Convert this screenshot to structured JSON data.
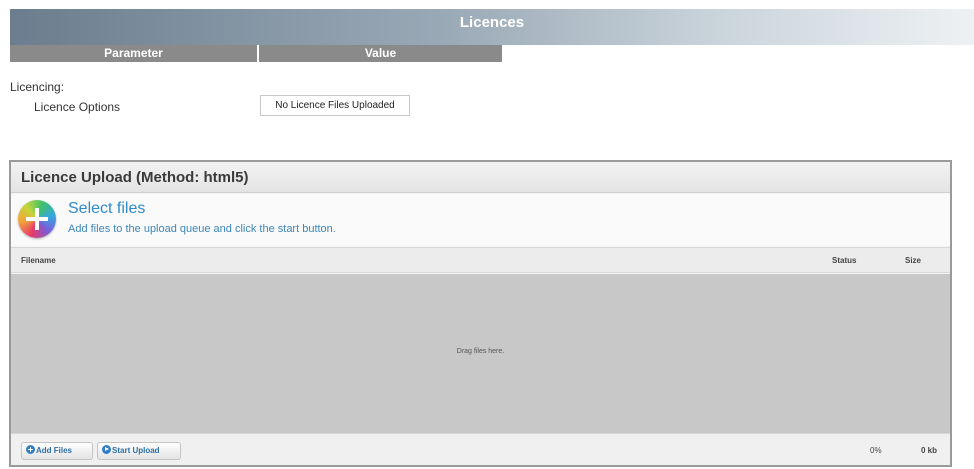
{
  "page": {
    "title": "Licences"
  },
  "params_table": {
    "header_parameter": "Parameter",
    "header_value": "Value",
    "section_label": "Licencing:",
    "rows": [
      {
        "label": "Licence Options",
        "value": "No Licence Files Uploaded"
      }
    ]
  },
  "uploader": {
    "title": "Licence Upload (Method: html5)",
    "select_title": "Select files",
    "select_subtitle": "Add files to the upload queue and click the start button.",
    "columns": {
      "filename": "Filename",
      "status": "Status",
      "size": "Size"
    },
    "drop_text": "Drag files here.",
    "add_files_label": "Add Files",
    "start_upload_label": "Start Upload",
    "total_percent": "0%",
    "total_size": "0 kb"
  },
  "colors": {
    "accent_text": "#2f8bc9",
    "header_bar": "#8a8a8a"
  }
}
